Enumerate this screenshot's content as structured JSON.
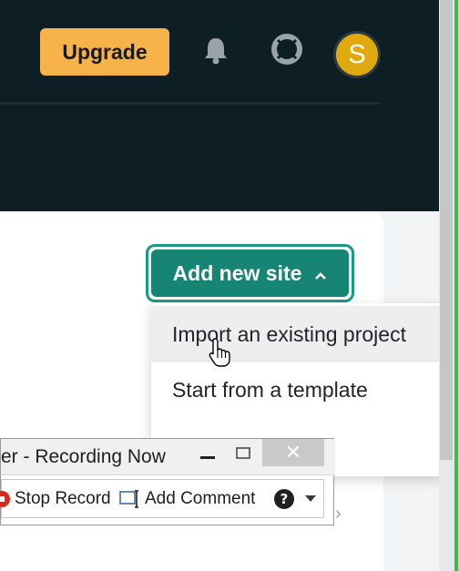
{
  "header": {
    "upgrade_label": "Upgrade",
    "avatar_initial": "S",
    "icons": [
      "bell-icon",
      "lifebuoy-icon"
    ]
  },
  "main": {
    "add_site_label": "Add new site",
    "add_site_icon": "chevron-up-icon",
    "dropdown": {
      "items": [
        {
          "label": "Import an existing project",
          "hovered": true
        },
        {
          "label": "Start from a template",
          "hovered": false
        }
      ]
    }
  },
  "recorder": {
    "title": "er - Recording Now",
    "stop_label": "Stop Record",
    "comment_label": "Add Comment",
    "close_icon": "close-icon"
  },
  "colors": {
    "header_bg": "#0e1e25",
    "upgrade_bg": "#f8b24a",
    "avatar_bg": "#e0aa0e",
    "primary": "#178573",
    "primary_ring": "#1a9a86"
  }
}
